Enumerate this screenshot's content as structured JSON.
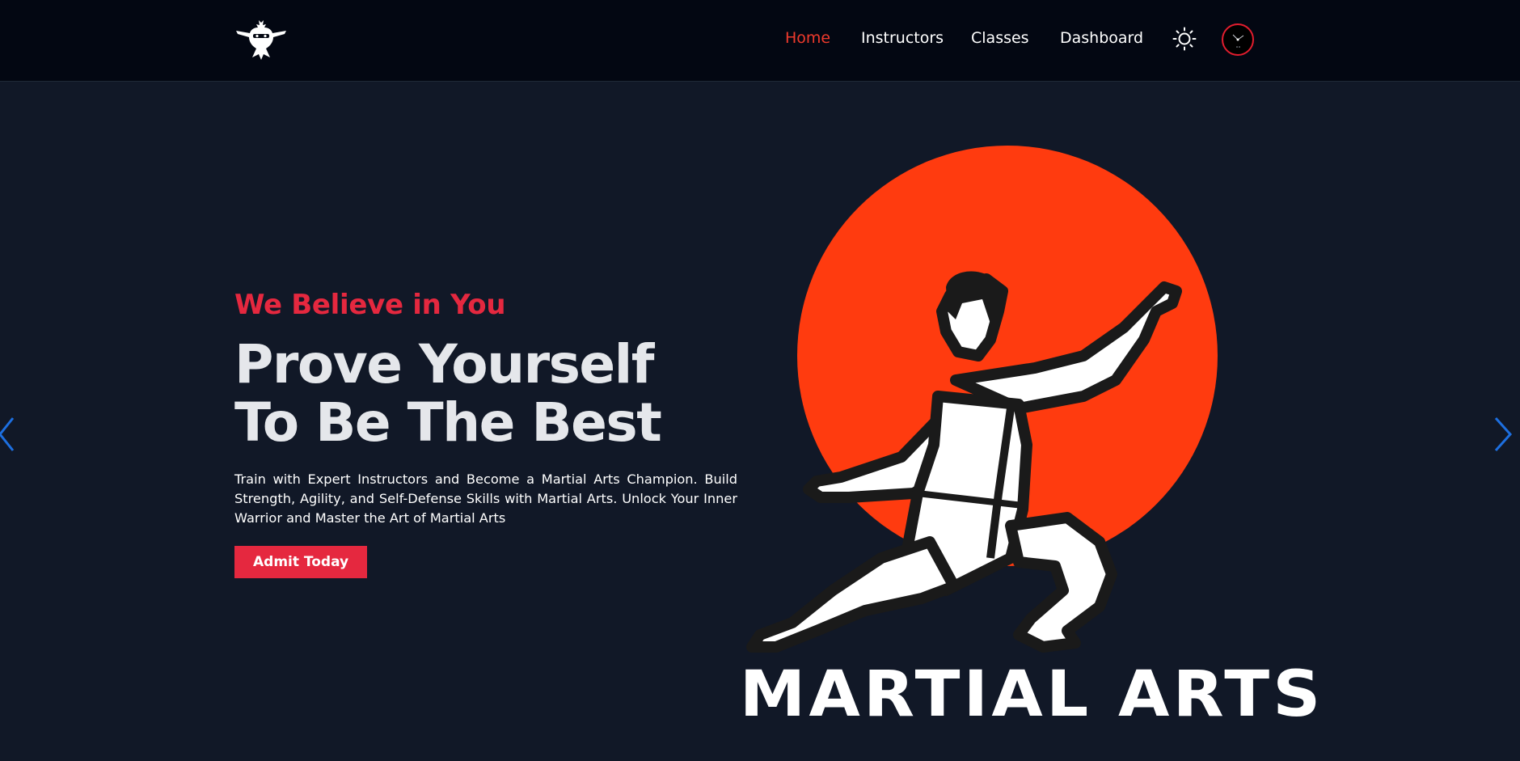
{
  "nav": {
    "logo_icon": "ninja-logo-icon",
    "links": [
      {
        "label": "Home",
        "active": true
      },
      {
        "label": "Instructors",
        "active": false
      },
      {
        "label": "Classes",
        "active": false
      },
      {
        "label": "Dashboard",
        "active": false
      }
    ],
    "theme_icon": "sun-icon",
    "avatar_icon": "user-avatar"
  },
  "hero": {
    "tagline": "We Believe in You",
    "headline_line1": "Prove Yourself",
    "headline_line2": "To Be The Best",
    "description": "Train with Expert Instructors and Become a Martial Arts Champion. Build Strength, Agility, and Self-Defense Skills with Martial Arts. Unlock Your Inner Warrior and Master the Art of Martial Arts",
    "cta_label": "Admit Today",
    "image_caption": "MARTIAL ARTS"
  },
  "carousel": {
    "prev_icon": "chevron-left-icon",
    "next_icon": "chevron-right-icon"
  },
  "colors": {
    "accent": "#e5283f",
    "active_nav": "#ef3a2c",
    "sun_circle": "#ff3b0f",
    "background": "#111827",
    "navbar": "#030712"
  }
}
